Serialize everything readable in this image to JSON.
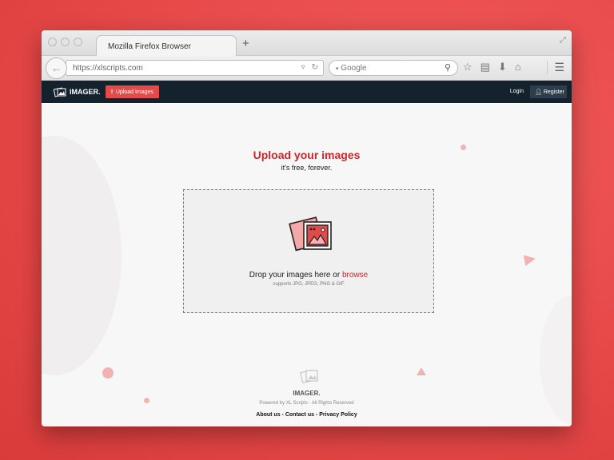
{
  "browser": {
    "tab_title": "Mozilla Firefox Browser",
    "new_tab_symbol": "+",
    "url": "https://xlscripts.com",
    "search_placeholder": "Google"
  },
  "site": {
    "logo_text": "IMAGER.",
    "upload_button": "Upload Images",
    "login": "Login",
    "register": "Register"
  },
  "main": {
    "title": "Upload your images",
    "subtitle": "it's free, forever.",
    "drop_text": "Drop your images here or",
    "browse_link": "browse",
    "supports": "supports JPG, JPEG, PNG & GIF"
  },
  "footer": {
    "name": "IMAGER.",
    "powered": "Powered by XL Scripts  - All Rights Reserved",
    "links": [
      "About us",
      "Contact us",
      "Privacy Policy"
    ],
    "separator": " - "
  },
  "colors": {
    "accent": "#c6282b",
    "header_bg": "#14222e",
    "upload_button_bg": "#e34a4a",
    "page_bg": "#e84a4a"
  }
}
